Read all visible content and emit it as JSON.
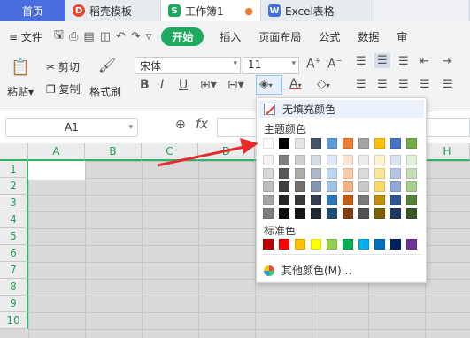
{
  "tabs": [
    {
      "label": "首页",
      "logo": ""
    },
    {
      "label": "稻壳模板",
      "logo": "D"
    },
    {
      "label": "工作簿1",
      "logo": "S"
    },
    {
      "label": "Excel表格",
      "logo": "W"
    }
  ],
  "menu": {
    "file": "文件",
    "start": "开始",
    "items": [
      "插入",
      "页面布局",
      "公式",
      "数据",
      "审"
    ]
  },
  "ribbon": {
    "paste": "粘贴",
    "cut": "剪切",
    "copy": "复制",
    "format_painter": "格式刷",
    "font_name": "宋体",
    "font_size": "11"
  },
  "formula_bar": {
    "name_box": "A1",
    "fx": "fx"
  },
  "grid": {
    "columns": [
      "A",
      "B",
      "C",
      "D",
      "E",
      "F",
      "G",
      "H"
    ],
    "rows": [
      "1",
      "2",
      "3",
      "4",
      "5",
      "6",
      "7",
      "8",
      "9",
      "10"
    ]
  },
  "fill_panel": {
    "no_fill": "无填充颜色",
    "theme_title": "主题颜色",
    "standard_title": "标准色",
    "more_colors": "其他颜色(M)...",
    "theme_top": [
      "#ffffff",
      "#000000",
      "#e7e6e6",
      "#44546a",
      "#5b9bd5",
      "#ed7d31",
      "#a5a5a5",
      "#ffc000",
      "#4472c4",
      "#70ad47"
    ],
    "theme_shades": [
      [
        "#f2f2f2",
        "#7f7f7f",
        "#d0cece",
        "#d6dce4",
        "#deebf6",
        "#fbe5d5",
        "#ededed",
        "#fff2cc",
        "#dae3f3",
        "#e2efd9"
      ],
      [
        "#d8d8d8",
        "#595959",
        "#aeabab",
        "#adb9ca",
        "#bdd7ee",
        "#f7cbac",
        "#dbdbdb",
        "#fee599",
        "#b4c6e7",
        "#c5e0b3"
      ],
      [
        "#bfbfbf",
        "#3f3f3f",
        "#757070",
        "#8496b0",
        "#9dc3e6",
        "#f4b183",
        "#c9c9c9",
        "#ffd966",
        "#8eaadb",
        "#a8d08d"
      ],
      [
        "#a5a5a5",
        "#262626",
        "#3a3838",
        "#323f4f",
        "#2e75b5",
        "#c55a11",
        "#7b7b7b",
        "#bf9000",
        "#2f5496",
        "#538135"
      ],
      [
        "#7f7f7f",
        "#0c0c0c",
        "#171616",
        "#222a35",
        "#1e4e79",
        "#833c0b",
        "#525252",
        "#7f6000",
        "#1f3864",
        "#375623"
      ]
    ],
    "standard": [
      "#c00000",
      "#ff0000",
      "#ffc000",
      "#ffff00",
      "#92d050",
      "#00b050",
      "#00b0f0",
      "#0070c0",
      "#002060",
      "#7030a0"
    ]
  },
  "accent": "#2eb36b"
}
